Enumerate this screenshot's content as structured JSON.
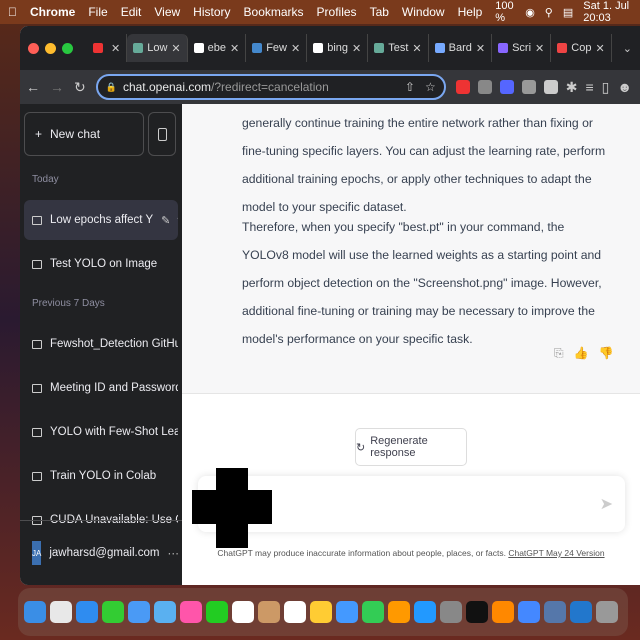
{
  "menubar": {
    "app": "Chrome",
    "items": [
      "File",
      "Edit",
      "View",
      "History",
      "Bookmarks",
      "Profiles",
      "Tab",
      "Window",
      "Help"
    ],
    "battery": "100 %",
    "datetime": "Sat 1. Jul  20:03"
  },
  "tabs": [
    {
      "label": "",
      "color": "#e33"
    },
    {
      "label": "Low",
      "color": "#6a9",
      "active": true
    },
    {
      "label": "ebe",
      "color": "#fff"
    },
    {
      "label": "Few",
      "color": "#48c"
    },
    {
      "label": "bing",
      "color": "#fff"
    },
    {
      "label": "Test",
      "color": "#6a9"
    },
    {
      "label": "Bard",
      "color": "#7af"
    },
    {
      "label": "Scri",
      "color": "#86f"
    },
    {
      "label": "Cop",
      "color": "#e44"
    }
  ],
  "address": {
    "host": "chat.openai.com",
    "path": "/?redirect=cancelation"
  },
  "sidebar": {
    "new_chat": "New chat",
    "today": "Today",
    "previous": "Previous 7 Days",
    "today_items": [
      "Low epochs affect Y",
      "Test YOLO on Image"
    ],
    "prev_items": [
      "Fewshot_Detection GitHub Im",
      "Meeting ID and Password",
      "YOLO with Few-Shot Learning",
      "Train YOLO in Colab",
      "CUDA Unavailable: Use CPU"
    ],
    "user": {
      "initials": "JA",
      "email": "jawharsd@gmail.com"
    }
  },
  "main": {
    "para1": "generally continue training the entire network rather than fixing or fine-tuning specific layers. You can adjust the learning rate, perform additional training epochs, or apply other techniques to adapt the model to your specific dataset.",
    "para2": "Therefore, when you specify \"best.pt\" in your command, the YOLOv8 model will use the learned weights as a starting point and perform object detection on the \"Screenshot.png\" image. However, additional fine-tuning or training may be necessary to improve the model's performance on your specific task.",
    "regenerate": "Regenerate response",
    "footer": "ChatGPT may produce inaccurate information about people, places, or facts.",
    "footer_link": "ChatGPT May 24 Version"
  },
  "dock_colors": [
    "#3a8ee6",
    "#e8e8e8",
    "#2f8cf0",
    "#3c3",
    "#4a9af5",
    "#5ab0f0",
    "#f5a",
    "#2c2",
    "#fff",
    "#c96",
    "#fff",
    "#fc3",
    "#49f",
    "#3c5",
    "#f90",
    "#29f",
    "#888",
    "#111",
    "#f80",
    "#48f",
    "#57a",
    "#27c",
    "#999"
  ]
}
